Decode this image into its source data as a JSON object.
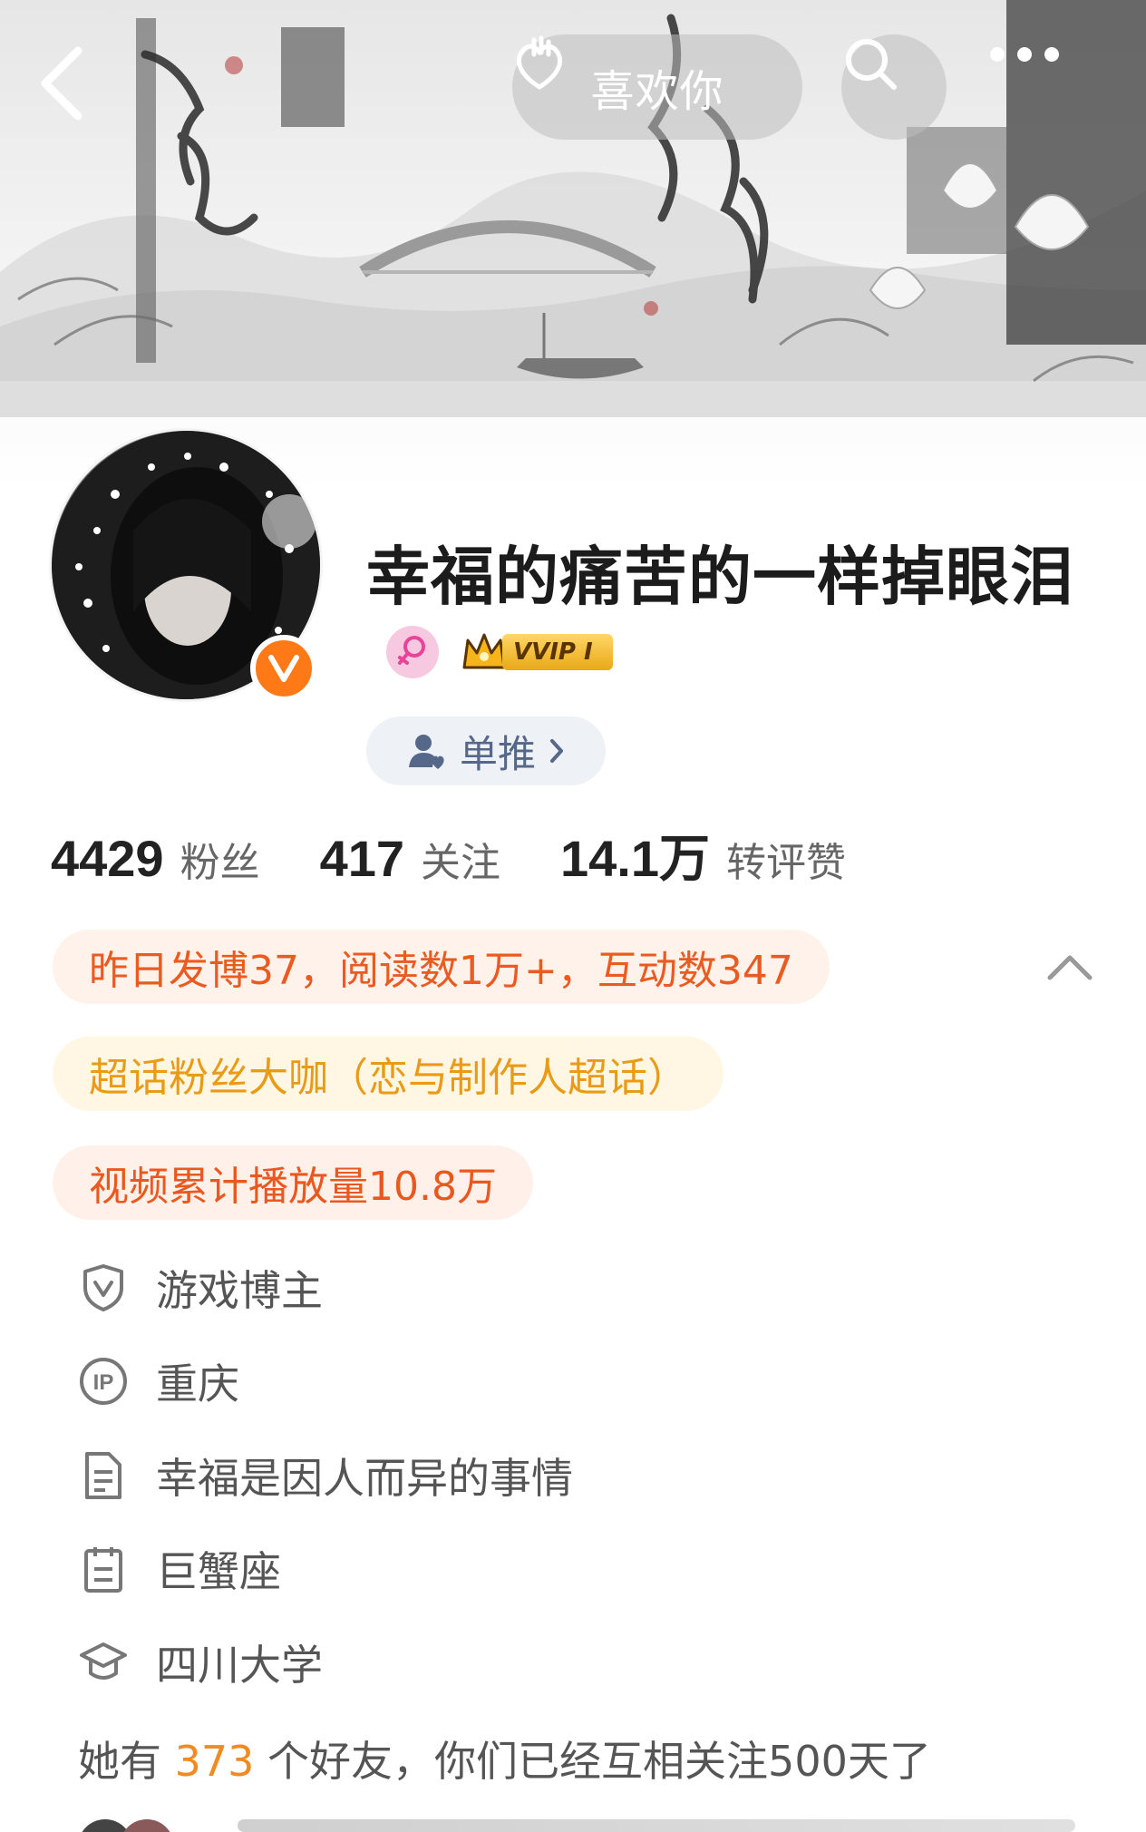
{
  "header": {
    "like_label": "喜欢你",
    "icons": [
      "back-icon",
      "heart-hand-icon",
      "search-icon",
      "more-icon"
    ]
  },
  "profile": {
    "username": "幸福的痛苦的一样掉眼泪",
    "vip_label": "VVIP I",
    "gender": "female",
    "push_label": "单推"
  },
  "stats": [
    {
      "value": "4429",
      "label": "粉丝"
    },
    {
      "value": "417",
      "label": "关注"
    },
    {
      "value": "14.1万",
      "label": "转评赞"
    }
  ],
  "chips": [
    "昨日发博37，阅读数1万+，互动数347",
    "超话粉丝大咖（恋与制作人超话）",
    "视频累计播放量10.8万"
  ],
  "info": [
    {
      "icon": "shield-v-icon",
      "text": "游戏博主"
    },
    {
      "icon": "ip-icon",
      "text": "重庆"
    },
    {
      "icon": "document-icon",
      "text": "幸福是因人而异的事情"
    },
    {
      "icon": "calendar-icon",
      "text": "巨蟹座"
    },
    {
      "icon": "graduation-cap-icon",
      "text": "四川大学"
    }
  ],
  "friends": {
    "prefix": "她有 ",
    "count": "373",
    "suffix": " 个好友，你们已经互相关注500天了"
  },
  "colors": {
    "accent_orange": "#ea5b21",
    "gold": "#e99b16",
    "verify": "#ff7a17",
    "highlight": "#f08b23"
  }
}
